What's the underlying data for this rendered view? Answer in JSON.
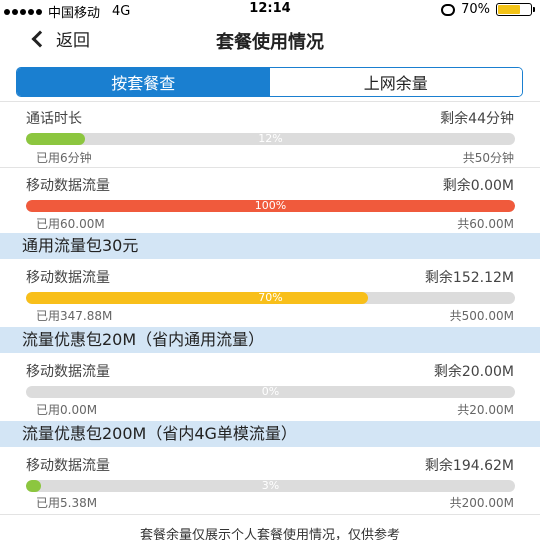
{
  "status_bar": {
    "carrier": "中国移动",
    "network": "4G",
    "time": "12:14",
    "battery": "70%",
    "battery_level": 0.7
  },
  "header": {
    "back_label": "返回",
    "title": "套餐使用情况"
  },
  "tabs": [
    {
      "label": "按套餐查",
      "active": true
    },
    {
      "label": "上网余量",
      "active": false
    }
  ],
  "usages": [
    {
      "name": "通话时长",
      "remain": "剩余44分钟",
      "percent": 12,
      "percent_label": "12%",
      "used": "已用6分钟",
      "total": "共50分钟",
      "color": "#8cc63f"
    },
    {
      "name": "移动数据流量",
      "remain": "剩余0.00M",
      "percent": 100,
      "percent_label": "100%",
      "used": "已用60.00M",
      "total": "共60.00M",
      "color": "#f05a3c"
    },
    {
      "name": "移动数据流量",
      "remain": "剩余152.12M",
      "percent": 70,
      "percent_label": "70%",
      "used": "已用347.88M",
      "total": "共500.00M",
      "color": "#f8bf1a"
    },
    {
      "name": "移动数据流量",
      "remain": "剩余20.00M",
      "percent": 0,
      "percent_label": "0%",
      "used": "已用0.00M",
      "total": "共20.00M",
      "color": "#8cc63f"
    },
    {
      "name": "移动数据流量",
      "remain": "剩余194.62M",
      "percent": 3,
      "percent_label": "3%",
      "used": "已用5.38M",
      "total": "共200.00M",
      "color": "#8cc63f"
    }
  ],
  "sections": [
    {
      "title": "通用流量包30元"
    },
    {
      "title": "流量优惠包20M（省内通用流量）"
    },
    {
      "title": "流量优惠包200M（省内4G单模流量）"
    }
  ],
  "footer": "套餐余量仅展示个人套餐使用情况，仅供参考"
}
